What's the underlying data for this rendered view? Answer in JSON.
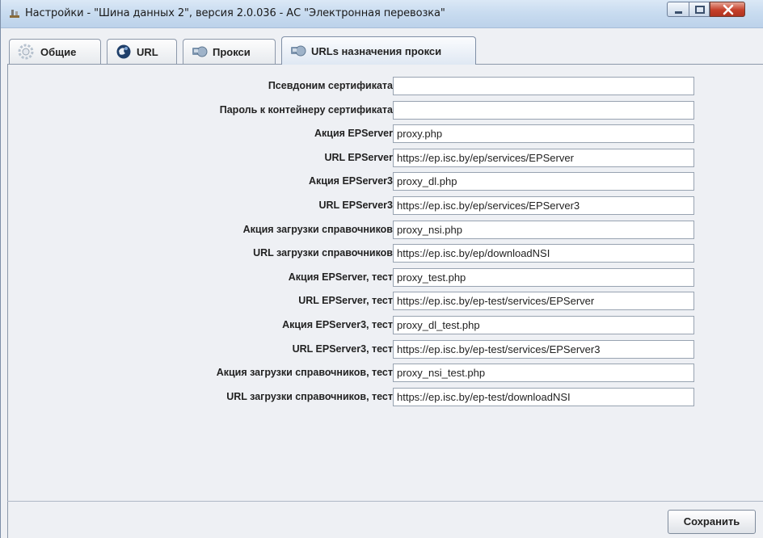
{
  "window": {
    "title": "Настройки - \"Шина данных 2\", версия 2.0.036 - АС \"Электронная перевозка\""
  },
  "tabs": [
    {
      "label": "Общие",
      "icon": "gear-icon",
      "selected": false
    },
    {
      "label": "URL",
      "icon": "globe-icon",
      "selected": false
    },
    {
      "label": "Прокси",
      "icon": "proxy-icon",
      "selected": false
    },
    {
      "label": "URLs назначения прокси",
      "icon": "proxy-icon",
      "selected": true
    }
  ],
  "form": {
    "rows": [
      {
        "label": "Псевдоним сертификата",
        "value": ""
      },
      {
        "label": "Пароль к контейнеру сертификата",
        "value": ""
      },
      {
        "label": "Акция EPServer",
        "value": "proxy.php"
      },
      {
        "label": "URL EPServer",
        "value": "https://ep.isc.by/ep/services/EPServer"
      },
      {
        "label": "Акция EPServer3",
        "value": "proxy_dl.php"
      },
      {
        "label": "URL EPServer3",
        "value": "https://ep.isc.by/ep/services/EPServer3"
      },
      {
        "label": "Акция загрузки справочников",
        "value": "proxy_nsi.php"
      },
      {
        "label": "URL загрузки справочников",
        "value": "https://ep.isc.by/ep/downloadNSI"
      },
      {
        "label": "Акция EPServer, тест",
        "value": "proxy_test.php"
      },
      {
        "label": "URL EPServer, тест",
        "value": "https://ep.isc.by/ep-test/services/EPServer"
      },
      {
        "label": "Акция EPServer3, тест",
        "value": "proxy_dl_test.php"
      },
      {
        "label": "URL EPServer3, тест",
        "value": "https://ep.isc.by/ep-test/services/EPServer3"
      },
      {
        "label": "Акция загрузки справочников, тест",
        "value": "proxy_nsi_test.php"
      },
      {
        "label": "URL загрузки справочников, тест",
        "value": "https://ep.isc.by/ep-test/downloadNSI"
      }
    ]
  },
  "footer": {
    "save_label": "Сохранить"
  }
}
